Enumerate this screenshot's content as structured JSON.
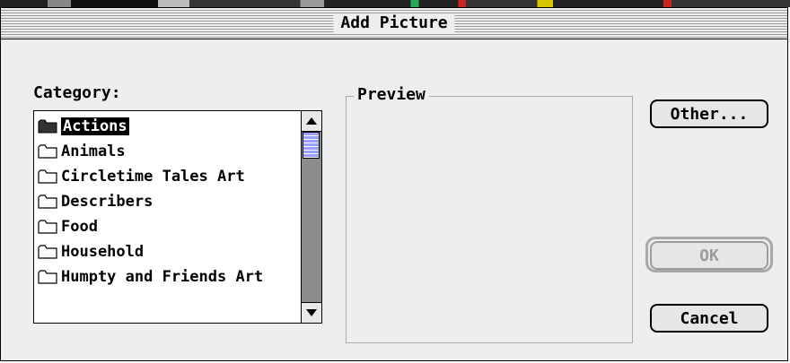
{
  "window": {
    "title": "Add Picture"
  },
  "category": {
    "label": "Category:",
    "items": [
      {
        "label": "Actions",
        "selected": true,
        "icon": "folder-filled-icon"
      },
      {
        "label": "Animals",
        "selected": false,
        "icon": "folder-icon"
      },
      {
        "label": "Circletime Tales Art",
        "selected": false,
        "icon": "folder-icon"
      },
      {
        "label": "Describers",
        "selected": false,
        "icon": "folder-icon"
      },
      {
        "label": "Food",
        "selected": false,
        "icon": "folder-icon"
      },
      {
        "label": "Household",
        "selected": false,
        "icon": "folder-icon"
      },
      {
        "label": "Humpty and Friends Art",
        "selected": false,
        "icon": "folder-icon"
      }
    ]
  },
  "preview": {
    "label": "Preview"
  },
  "buttons": {
    "other": "Other...",
    "ok": "OK",
    "cancel": "Cancel"
  },
  "colors": {
    "scroll_thumb": "#9aa0ff",
    "disabled_text": "#9c9c9c"
  }
}
